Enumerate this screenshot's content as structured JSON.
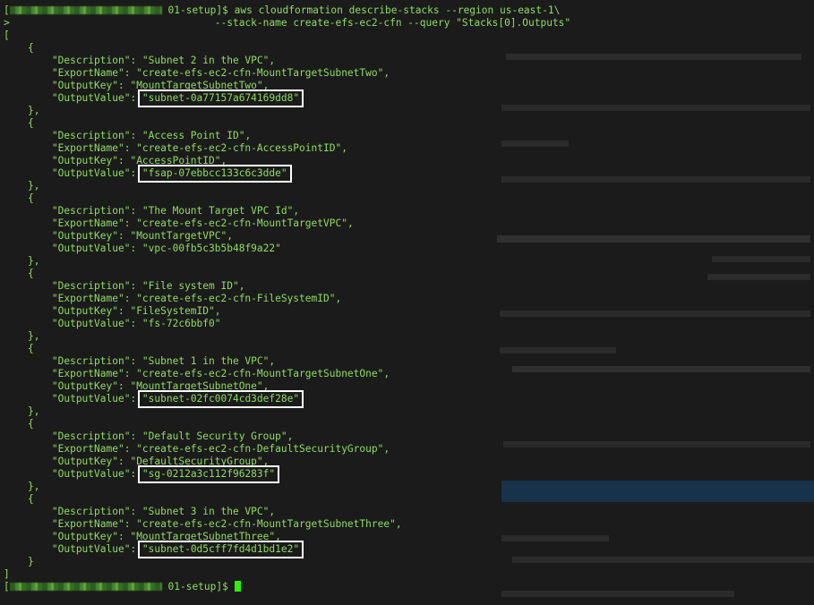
{
  "terminal": {
    "prompt_path": "01-setup",
    "prompt_suffix": "]$",
    "command_line1": "aws cloudformation describe-stacks --region us-east-1\\",
    "command_line2": "--stack-name create-efs-ec2-cfn --query \"Stacks[0].Outputs\"",
    "continuation_marker": ">",
    "array_open": "[",
    "array_close": "]",
    "obj_open": "{",
    "obj_close": "},",
    "obj_close_last": "}",
    "outputs": [
      {
        "description": "Subnet 2 in the VPC",
        "export_name": "create-efs-ec2-cfn-MountTargetSubnetTwo",
        "output_key": "MountTargetSubnetTwo",
        "output_value": "subnet-0a77157a674169dd8",
        "highlighted": true
      },
      {
        "description": "Access Point ID",
        "export_name": "create-efs-ec2-cfn-AccessPointID",
        "output_key": "AccessPointID",
        "output_value": "fsap-07ebbcc133c6c3dde",
        "highlighted": true
      },
      {
        "description": "The Mount Target VPC Id",
        "export_name": "create-efs-ec2-cfn-MountTargetVPC",
        "output_key": "MountTargetVPC",
        "output_value": "vpc-00fb5c3b5b48f9a22",
        "highlighted": false
      },
      {
        "description": "File system ID",
        "export_name": "create-efs-ec2-cfn-FileSystemID",
        "output_key": "FileSystemID",
        "output_value": "fs-72c6bbf0",
        "highlighted": false
      },
      {
        "description": "Subnet 1 in the VPC",
        "export_name": "create-efs-ec2-cfn-MountTargetSubnetOne",
        "output_key": "MountTargetSubnetOne",
        "output_value": "subnet-02fc0074cd3def28e",
        "highlighted": true
      },
      {
        "description": "Default Security Group",
        "export_name": "create-efs-ec2-cfn-DefaultSecurityGroup",
        "output_key": "DefaultSecurityGroup",
        "output_value": "sg-0212a3c112f96283f",
        "highlighted": true
      },
      {
        "description": "Subnet 3 in the VPC",
        "export_name": "create-efs-ec2-cfn-MountTargetSubnetThree",
        "output_key": "MountTargetSubnetThree",
        "output_value": "subnet-0d5cff7fd4d1bd1e2",
        "highlighted": true
      }
    ],
    "colors": {
      "background": "#1b1b1b",
      "text": "#8fdc62",
      "highlight_box": "#ffffff",
      "cursor": "#2ef00a"
    }
  }
}
